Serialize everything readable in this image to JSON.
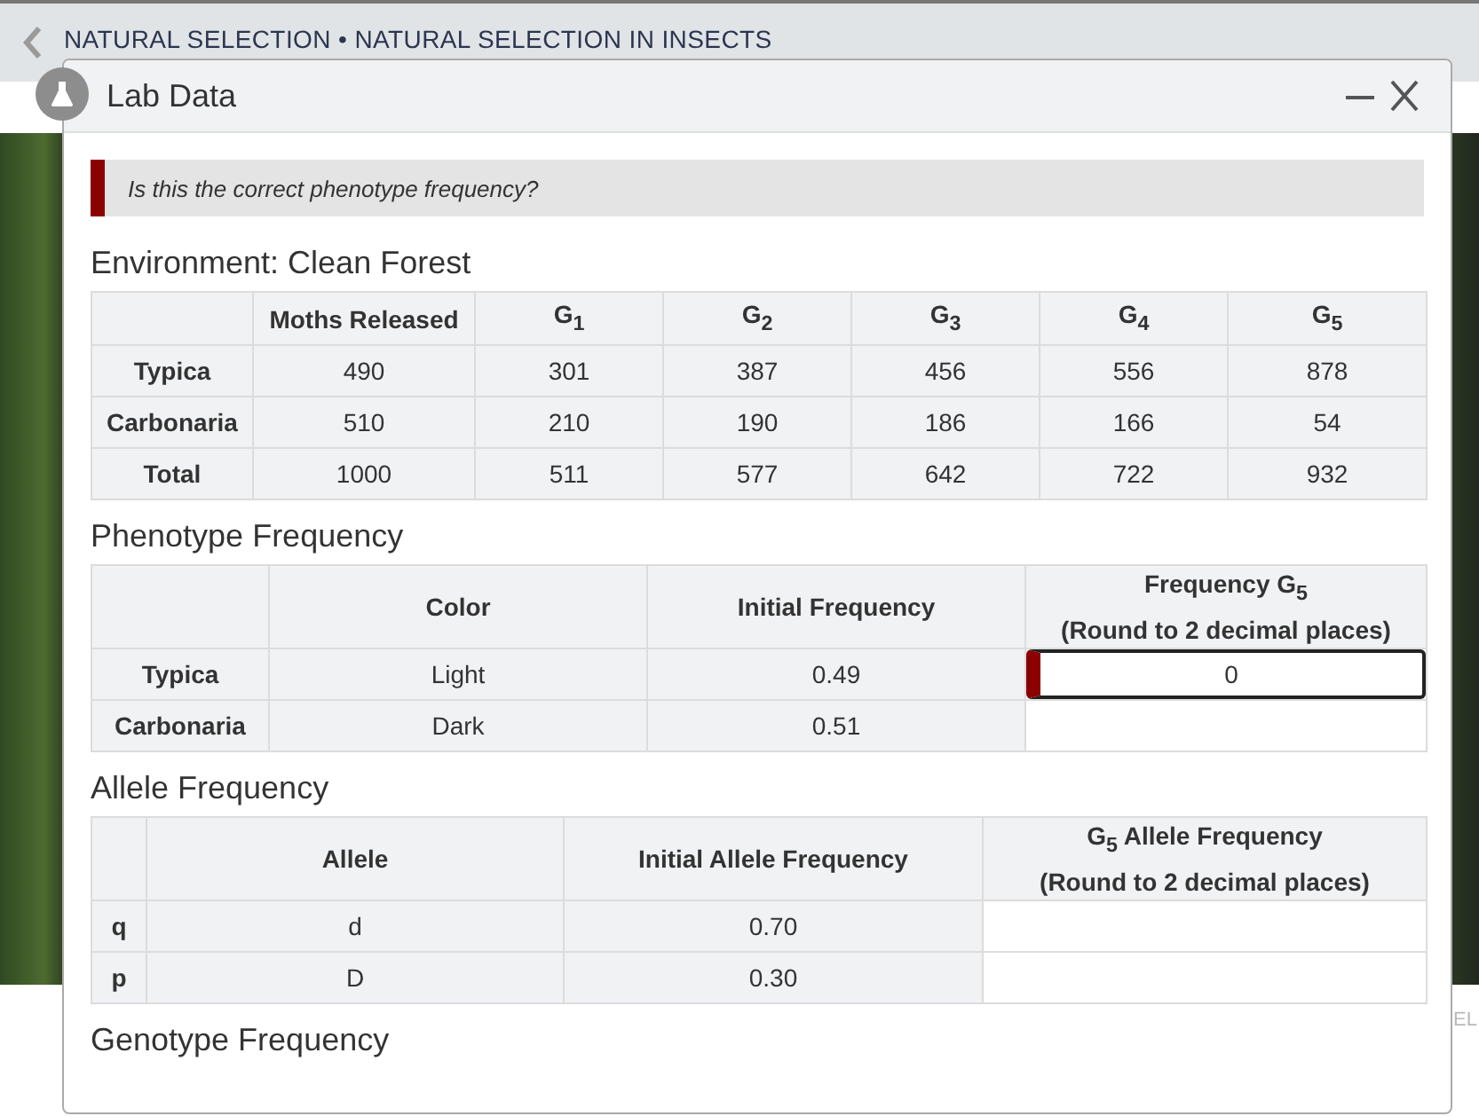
{
  "breadcrumb": "NATURAL SELECTION • NATURAL SELECTION IN INSECTS",
  "background_text": "EL",
  "dialog": {
    "title": "Lab Data",
    "feedback": "Is this the correct phenotype frequency?",
    "sections": [
      {
        "heading": "Environment: Clean Forest",
        "kind": "counts",
        "columns": [
          "",
          "Moths Released",
          "G$_{1}$",
          "G$_{2}$",
          "G$_{3}$",
          "G$_{4}$",
          "G$_{5}$"
        ],
        "rows": [
          {
            "cells": [
              "Typica",
              "490",
              "301",
              "387",
              "456",
              "556",
              "878"
            ]
          },
          {
            "cells": [
              "Carbonaria",
              "510",
              "210",
              "190",
              "186",
              "166",
              "54"
            ]
          },
          {
            "cells": [
              "Total",
              "1000",
              "511",
              "577",
              "642",
              "722",
              "932"
            ]
          }
        ]
      },
      {
        "heading": "Phenotype Frequency",
        "kind": "answer",
        "columns": [
          "",
          "Color",
          "Initial Frequency",
          "Frequency G$_{5}$\n(Round to 2 decimal places)"
        ],
        "rows": [
          {
            "cells": [
              "Typica",
              "Light",
              "0.49"
            ],
            "answer": {
              "value": "0",
              "flagged": true
            }
          },
          {
            "cells": [
              "Carbonaria",
              "Dark",
              "0.51"
            ]
          }
        ]
      },
      {
        "heading": "Allele Frequency",
        "kind": "answer",
        "columns": [
          "",
          "Allele",
          "Initial Allele Frequency",
          "G$_{5}$ Allele Frequency\n(Round to 2 decimal places)"
        ],
        "rows": [
          {
            "cells": [
              "q",
              "d",
              "0.70"
            ]
          },
          {
            "cells": [
              "p",
              "D",
              "0.30"
            ]
          }
        ]
      },
      {
        "heading": "Genotype Frequency",
        "kind": "heading_only"
      }
    ]
  }
}
